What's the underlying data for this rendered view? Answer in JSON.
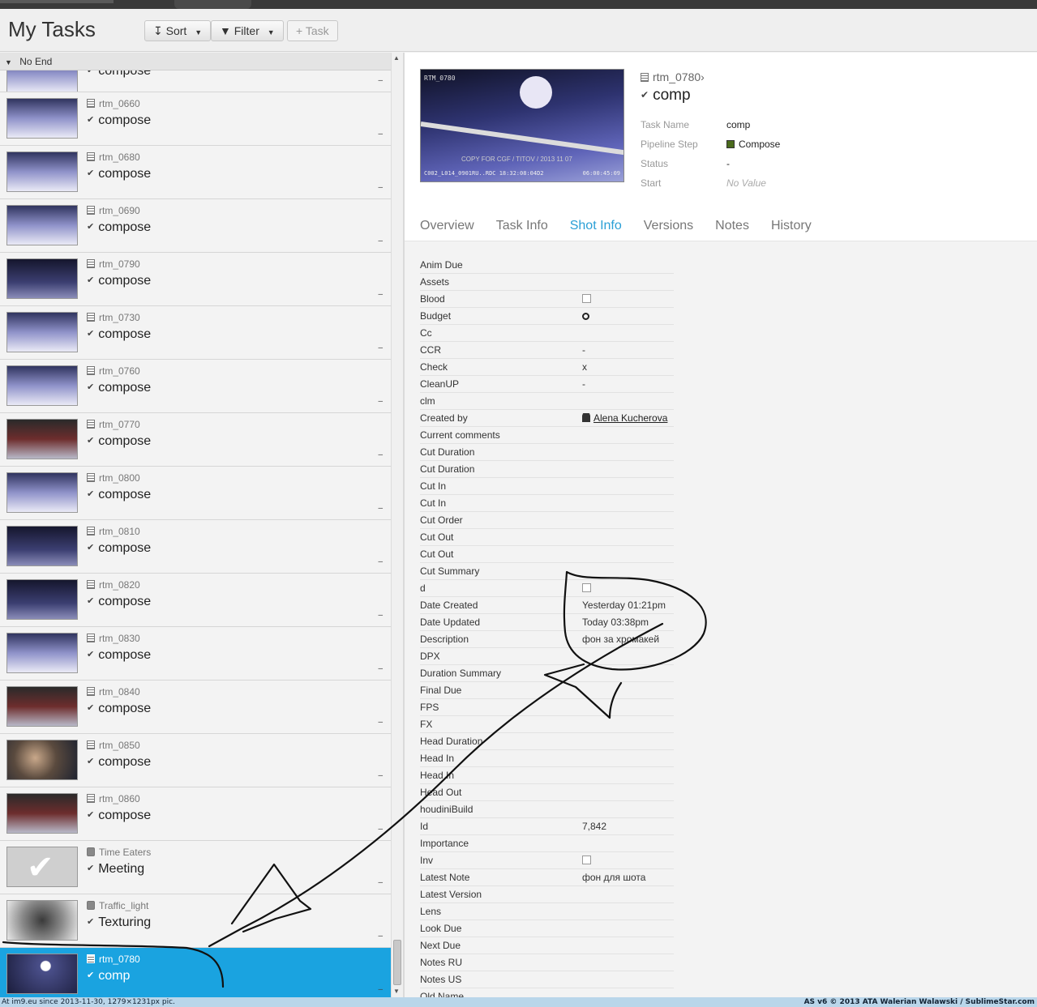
{
  "header": {
    "title": "My Tasks",
    "sort_label": "Sort",
    "filter_label": "Filter",
    "task_label": "Task"
  },
  "group": {
    "label": "No End"
  },
  "tasks": [
    {
      "entity": "",
      "task": "compose",
      "thumb": "snow",
      "partial": true
    },
    {
      "entity": "rtm_0660",
      "task": "compose",
      "thumb": "snow"
    },
    {
      "entity": "rtm_0680",
      "task": "compose",
      "thumb": "snow"
    },
    {
      "entity": "rtm_0690",
      "task": "compose",
      "thumb": "snow"
    },
    {
      "entity": "rtm_0790",
      "task": "compose",
      "thumb": "dark"
    },
    {
      "entity": "rtm_0730",
      "task": "compose",
      "thumb": "snow"
    },
    {
      "entity": "rtm_0760",
      "task": "compose",
      "thumb": "snow"
    },
    {
      "entity": "rtm_0770",
      "task": "compose",
      "thumb": "red"
    },
    {
      "entity": "rtm_0800",
      "task": "compose",
      "thumb": "snow"
    },
    {
      "entity": "rtm_0810",
      "task": "compose",
      "thumb": "dark"
    },
    {
      "entity": "rtm_0820",
      "task": "compose",
      "thumb": "dark"
    },
    {
      "entity": "rtm_0830",
      "task": "compose",
      "thumb": "snow"
    },
    {
      "entity": "rtm_0840",
      "task": "compose",
      "thumb": "red"
    },
    {
      "entity": "rtm_0850",
      "task": "compose",
      "thumb": "face"
    },
    {
      "entity": "rtm_0860",
      "task": "compose",
      "thumb": "red"
    },
    {
      "entity": "Time Eaters",
      "task": "Meeting",
      "thumb": "white",
      "asset": true
    },
    {
      "entity": "Traffic_light",
      "task": "Texturing",
      "thumb": "light",
      "asset": true
    },
    {
      "entity": "rtm_0780",
      "task": "comp",
      "thumb": "moon",
      "selected": true
    }
  ],
  "detail": {
    "entity": "rtm_0780",
    "task": "comp",
    "preview": {
      "top_left": "RTM_0780",
      "watermark": "COPY FOR CGF / TITOV / 2013 11 07",
      "bottom_left": "C002_L014_0901RU..RDC 18:32:08:04D2",
      "bottom_right": "06:00:45:09"
    },
    "meta": [
      {
        "label": "Task Name",
        "value": "comp"
      },
      {
        "label": "Pipeline Step",
        "value": "Compose",
        "swatch": "#4a6a1c"
      },
      {
        "label": "Status",
        "value": "-"
      },
      {
        "label": "Start",
        "value": "No Value",
        "novalue": true
      }
    ],
    "tabs": [
      "Overview",
      "Task Info",
      "Shot Info",
      "Versions",
      "Notes",
      "History"
    ],
    "active_tab": "Shot Info",
    "fields": [
      {
        "label": "Anim Due",
        "value": ""
      },
      {
        "label": "Assets",
        "value": ""
      },
      {
        "label": "Blood",
        "value": "",
        "kind": "checkbox"
      },
      {
        "label": "Budget",
        "value": "",
        "kind": "circle"
      },
      {
        "label": "Cc",
        "value": ""
      },
      {
        "label": "CCR",
        "value": "-"
      },
      {
        "label": "Check",
        "value": "x"
      },
      {
        "label": "CleanUP",
        "value": "-"
      },
      {
        "label": "clm",
        "value": ""
      },
      {
        "label": "Created by",
        "value": "Alena Kucherova",
        "kind": "user"
      },
      {
        "label": "Current comments",
        "value": ""
      },
      {
        "label": "Cut Duration",
        "value": ""
      },
      {
        "label": "Cut Duration",
        "value": ""
      },
      {
        "label": "Cut In",
        "value": ""
      },
      {
        "label": "Cut In",
        "value": ""
      },
      {
        "label": "Cut Order",
        "value": ""
      },
      {
        "label": "Cut Out",
        "value": ""
      },
      {
        "label": "Cut Out",
        "value": ""
      },
      {
        "label": "Cut Summary",
        "value": ""
      },
      {
        "label": "d",
        "value": "",
        "kind": "checkbox"
      },
      {
        "label": "Date Created",
        "value": "Yesterday 01:21pm"
      },
      {
        "label": "Date Updated",
        "value": "Today 03:38pm"
      },
      {
        "label": "Description",
        "value": "фон за хромакей"
      },
      {
        "label": "DPX",
        "value": ""
      },
      {
        "label": "Duration Summary",
        "value": ""
      },
      {
        "label": "Final Due",
        "value": ""
      },
      {
        "label": "FPS",
        "value": ""
      },
      {
        "label": "FX",
        "value": ""
      },
      {
        "label": "Head Duration",
        "value": ""
      },
      {
        "label": "Head In",
        "value": ""
      },
      {
        "label": "Head In",
        "value": ""
      },
      {
        "label": "Head Out",
        "value": ""
      },
      {
        "label": "houdiniBuild",
        "value": ""
      },
      {
        "label": "Id",
        "value": "7,842"
      },
      {
        "label": "Importance",
        "value": ""
      },
      {
        "label": "Inv",
        "value": "",
        "kind": "checkbox"
      },
      {
        "label": "Latest Note",
        "value": "фон для шота"
      },
      {
        "label": "Latest Version",
        "value": ""
      },
      {
        "label": "Lens",
        "value": ""
      },
      {
        "label": "Look Due",
        "value": ""
      },
      {
        "label": "Next Due",
        "value": ""
      },
      {
        "label": "Notes RU",
        "value": ""
      },
      {
        "label": "Notes US",
        "value": ""
      },
      {
        "label": "Old Name",
        "value": ""
      }
    ]
  },
  "footer": {
    "left": "At im9.eu  since 2013-11-30, 1279×1231px pic.",
    "right": "AS v6 © 2013 ATA Walerian Walawski / SublimeStar.com"
  },
  "colors": {
    "accent": "#2a9fd6",
    "selected": "#1aa3e0",
    "pipeline_compose": "#4a6a1c"
  }
}
